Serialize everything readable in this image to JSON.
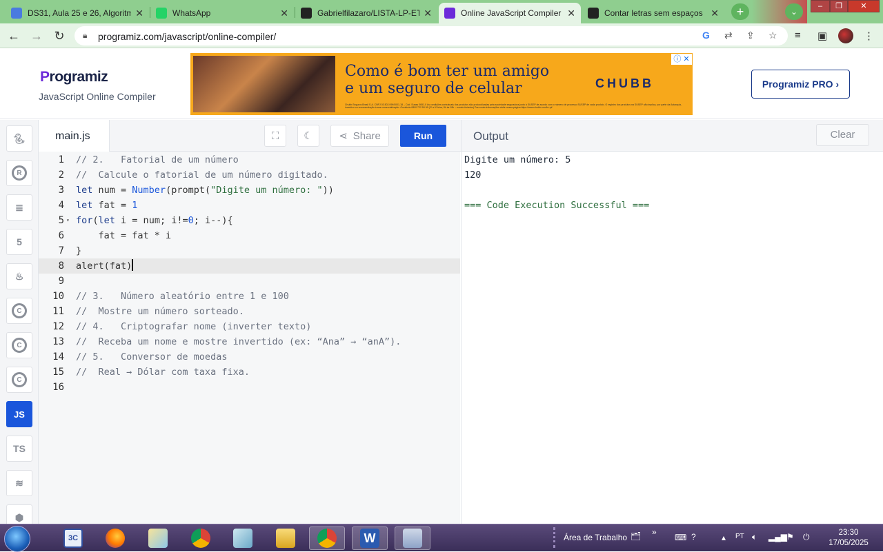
{
  "browser": {
    "tabs": [
      {
        "title": "DS31, Aula 25 e 26, Algoritm",
        "active": false,
        "favicon_color": "#4a7be0"
      },
      {
        "title": "WhatsApp",
        "active": false,
        "favicon_color": "#25d366"
      },
      {
        "title": "Gabrielfilazaro/LISTA-LP-ET",
        "active": false,
        "favicon_color": "#222222"
      },
      {
        "title": "Online JavaScript Compiler",
        "active": true,
        "favicon_color": "#6c2bd9"
      },
      {
        "title": "Contar letras sem espaços",
        "active": false,
        "favicon_color": "#222222"
      }
    ],
    "close_glyph": "✕",
    "new_tab_glyph": "+",
    "url": "programiz.com/javascript/online-compiler/"
  },
  "header": {
    "logo_text": "rogramiz",
    "logo_p": "P",
    "subtitle": "JavaScript Online Compiler",
    "pro_button": "Programiz PRO ›"
  },
  "ad": {
    "headline_line1": "Como é bom ter um amigo",
    "headline_line2": "e um seguro de celular",
    "brand": "CHUBB",
    "fine_print": "Chubb Seguros Brasil S.A. CNPJ 03.502.099/0001-18 – Cód. Susep 0651-0 As condições contratuais dos produtos são protocolizadas pela sociedade seguradora junto à SUSEP de acordo com o número de processo SUSEP de cada produto. O registro dos produtos na SUSEP não implica, por parte da Autarquia, incentivo ou recomendação à sua comercialização. Ouvidoria 0800 722 50 59 (2ª a 6ª feira, 8h às 18h – exceto feriados) Para mais informações visite nossa página https://www.chubb.com/br-pt/"
  },
  "sidebar": {
    "languages": [
      {
        "name": "python",
        "label": "",
        "active": false
      },
      {
        "name": "r",
        "label": "R",
        "active": false
      },
      {
        "name": "sql",
        "label": "",
        "active": false
      },
      {
        "name": "html",
        "label": "5",
        "active": false
      },
      {
        "name": "java",
        "label": "",
        "active": false
      },
      {
        "name": "c",
        "label": "C",
        "active": false
      },
      {
        "name": "cpp",
        "label": "C",
        "active": false
      },
      {
        "name": "csharp",
        "label": "C",
        "active": false
      },
      {
        "name": "javascript",
        "label": "JS",
        "active": true
      },
      {
        "name": "typescript",
        "label": "TS",
        "active": false
      },
      {
        "name": "scala",
        "label": "",
        "active": false
      },
      {
        "name": "go",
        "label": "",
        "active": false
      }
    ]
  },
  "editor": {
    "file_name": "main.js",
    "share_label": "Share",
    "run_label": "Run",
    "current_line": 8,
    "lines": [
      "// 2.   Fatorial de um número",
      "//  Calcule o fatorial de um número digitado.",
      "let num = Number(prompt(\"Digite um número: \"))",
      "let fat = 1",
      "for(let i = num; i!=0; i--){",
      "    fat = fat * i",
      "}",
      "alert(fat)",
      "",
      "// 3.   Número aleatório entre 1 e 100",
      "//  Mostre um número sorteado.",
      "// 4.   Criptografar nome (inverter texto)",
      "//  Receba um nome e mostre invertido (ex: “Ana” → “anA”).",
      "// 5.   Conversor de moedas",
      "//  Real → Dólar com taxa fixa.",
      ""
    ]
  },
  "output": {
    "title": "Output",
    "clear_label": "Clear",
    "lines": [
      "Digite um número: 5",
      "120",
      "",
      "=== Code Execution Successful ==="
    ]
  },
  "taskbar": {
    "tray_label": "Área de Trabalho",
    "time": "23:30",
    "date": "17/05/2025",
    "apps": [
      "calculator-3c",
      "firefox",
      "folder-images",
      "chrome",
      "notepad",
      "explorer",
      "chrome-active",
      "word",
      "calc"
    ]
  }
}
